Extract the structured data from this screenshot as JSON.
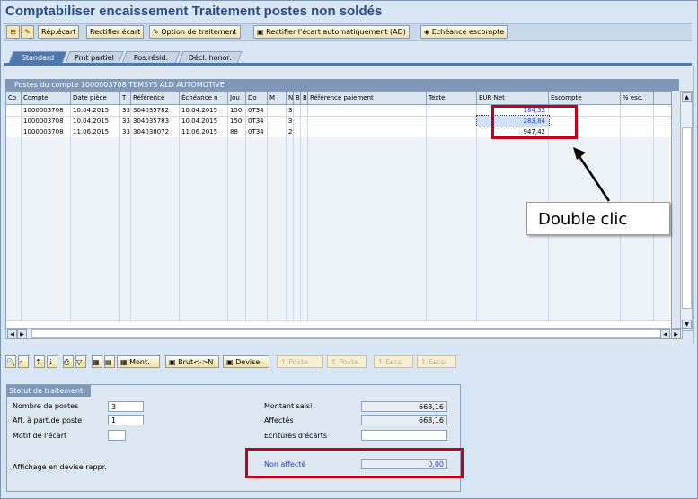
{
  "window": {
    "title": "Comptabiliser encaissement Traitement postes non soldés"
  },
  "toolbar": {
    "rep_ecart": "Rép.écart",
    "rectifier_ecart": "Rectifier écart",
    "option_traitement": "Option de traitement",
    "rectifier_auto": "Rectifier l'écart automatiquement (AD)",
    "echeance_escompte": "Echéance escompte"
  },
  "tabs": [
    "Standard",
    "Pmt partiel",
    "Pos.résid.",
    "Décl. honor."
  ],
  "grid": {
    "title": "Postes du compte 1000003708 TEMSYS ALD AUTOMOTIVE",
    "columns": [
      "Co",
      "Compte",
      "Date pièce",
      "T",
      "Référence",
      "Échéance n",
      "Jou",
      "Do",
      "M",
      "N",
      "B",
      "B",
      "Référence paiement",
      "Texte",
      "EUR Net",
      "Escompte",
      "% esc."
    ],
    "rows": [
      [
        "",
        "1000003708",
        "10.04.2015",
        "33",
        "304035782",
        "10.04.2015",
        "150",
        "0T34",
        "",
        "3",
        "",
        "",
        "",
        "",
        "184,32",
        "",
        ""
      ],
      [
        "",
        "1000003708",
        "10.04.2015",
        "33",
        "304035783",
        "10.04.2015",
        "150",
        "0T34",
        "",
        "3",
        "",
        "",
        "",
        "",
        "283,84",
        "",
        ""
      ],
      [
        "",
        "1000003708",
        "11.06.2015",
        "33",
        "304038072",
        "11.06.2015",
        "88",
        "0T34",
        "",
        "2",
        "",
        "",
        "",
        "",
        "947,42",
        "",
        ""
      ]
    ]
  },
  "buttons": {
    "mont": "Mont.",
    "brut_net": "Brut<->N",
    "devise": "Devise",
    "poste1": "Poste",
    "poste2": "Poste",
    "escp1": "Escp",
    "escp2": "Escp"
  },
  "status": {
    "title": "Statut de traitement",
    "nombre_postes_label": "Nombre de postes",
    "nombre_postes_value": "3",
    "aff_part_label": "Aff. à part.de poste",
    "aff_part_value": "1",
    "motif_label": "Motif de l'écart",
    "motif_value": "",
    "affichage_label": "Affichage en devise rappr.",
    "montant_saisi_label": "Montant saisi",
    "montant_saisi_value": "668,16",
    "affectes_label": "Affectés",
    "affectes_value": "668,16",
    "ecritures_label": "Ecritures d'écarts",
    "ecritures_value": "",
    "non_affecte_label": "Non affecté",
    "non_affecte_value": "0,00"
  },
  "annotation": {
    "callout_text": "Double clic"
  },
  "colors": {
    "accent": "#4d78ad",
    "highlight": "#c4001a",
    "title": "#294e86"
  }
}
